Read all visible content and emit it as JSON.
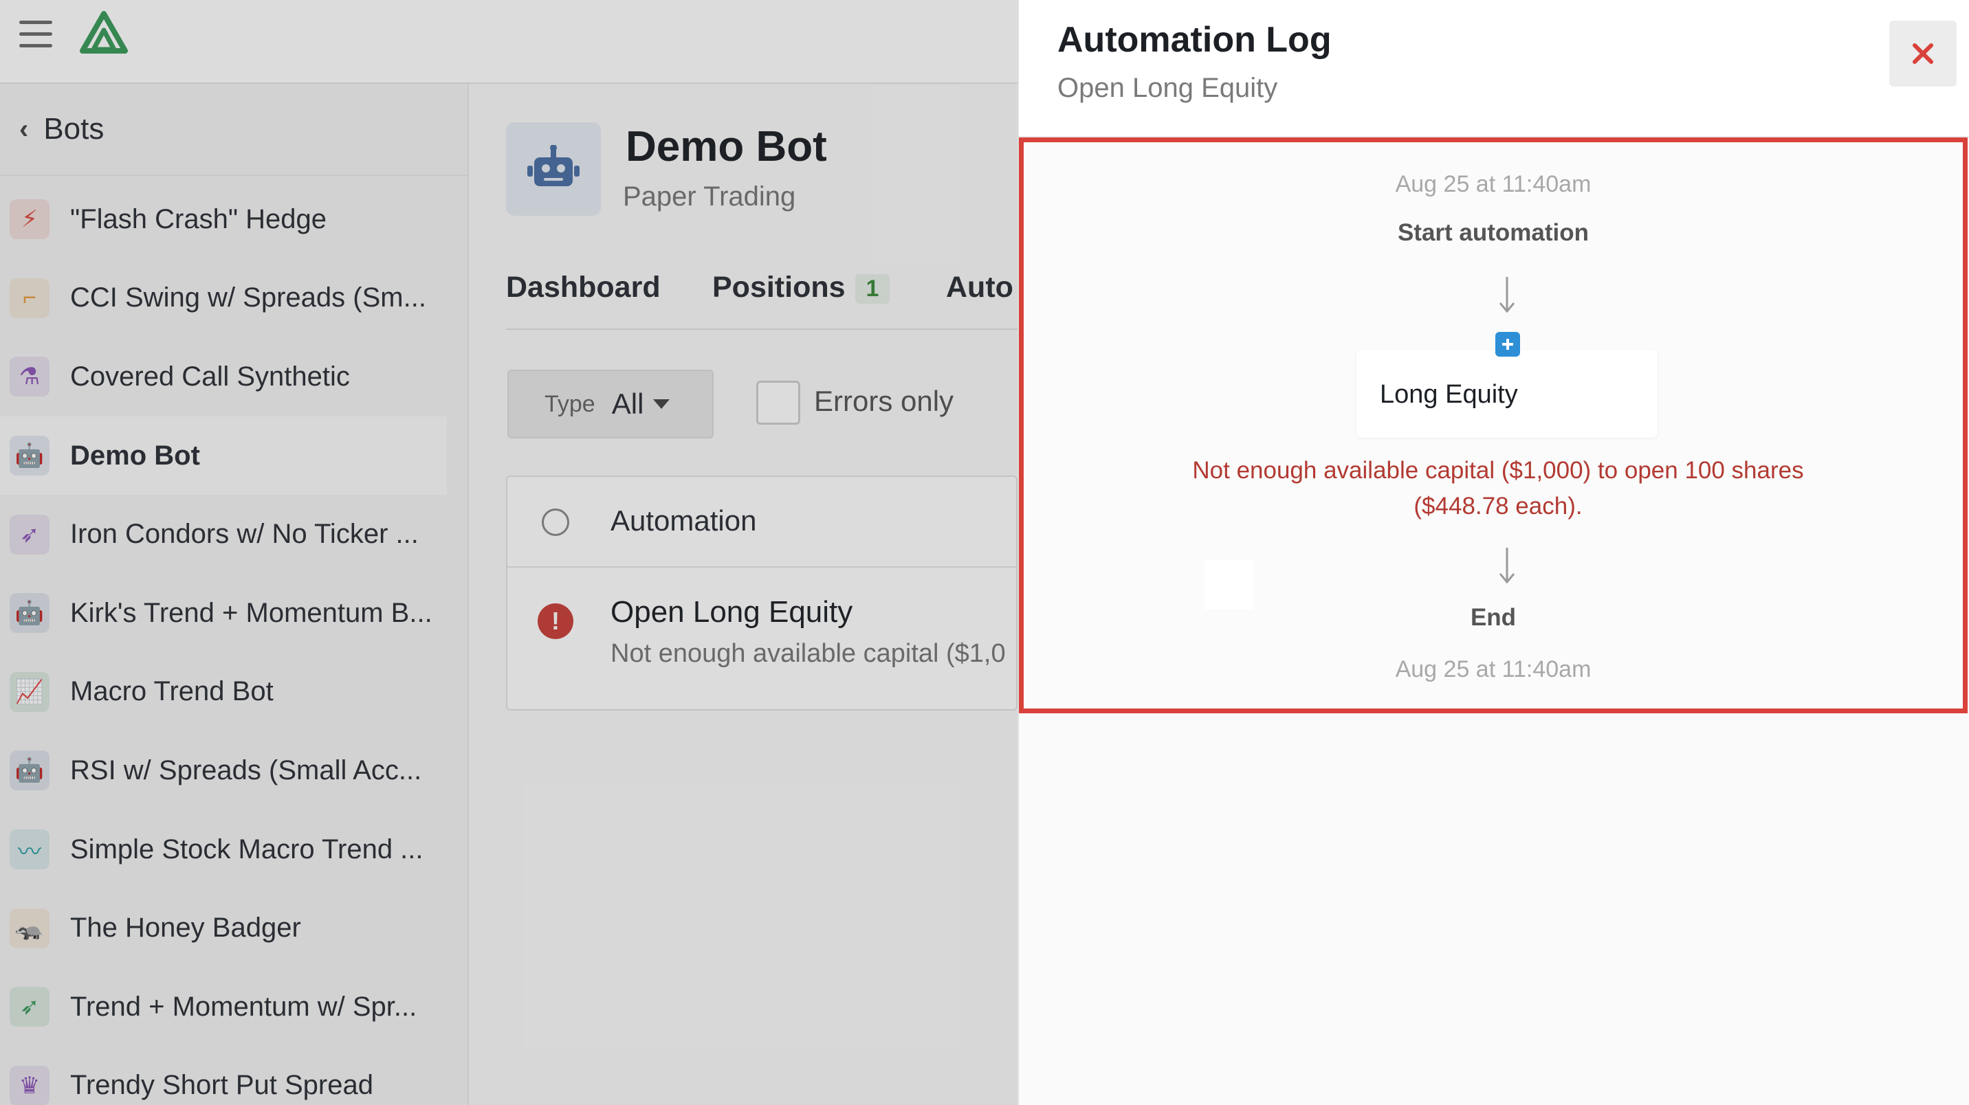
{
  "app": {
    "sidebar": {
      "back_label": "Bots",
      "items": [
        {
          "label": "\"Flash Crash\" Hedge",
          "icon": "lightning-icon",
          "color": "#d94a3f",
          "active": false
        },
        {
          "label": "CCI Swing w/ Spreads (Sm...",
          "icon": "gun-icon",
          "color": "#e39a3b",
          "active": false
        },
        {
          "label": "Covered Call Synthetic",
          "icon": "chemistry-flask-icon",
          "color": "#8d57b8",
          "active": false
        },
        {
          "label": "Demo Bot",
          "icon": "robot-icon",
          "color": "#4a6fa5",
          "active": true
        },
        {
          "label": "Iron Condors w/ No Ticker ...",
          "icon": "rocket-icon",
          "color": "#8d57b8",
          "active": false
        },
        {
          "label": "Kirk's Trend + Momentum B...",
          "icon": "robot-icon",
          "color": "#4a6fa5",
          "active": false
        },
        {
          "label": "Macro Trend Bot",
          "icon": "line-chart-icon",
          "color": "#3a9a5a",
          "active": false
        },
        {
          "label": "RSI w/ Spreads (Small Acc...",
          "icon": "robot-icon",
          "color": "#4a6fa5",
          "active": false
        },
        {
          "label": "Simple Stock Macro Trend ...",
          "icon": "pulse-icon",
          "color": "#2a9da6",
          "active": false
        },
        {
          "label": "The Honey Badger",
          "icon": "badger-icon",
          "color": "#e39a3b",
          "active": false
        },
        {
          "label": "Trend + Momentum w/ Spr...",
          "icon": "rocket-icon",
          "color": "#3a9a5a",
          "active": false
        },
        {
          "label": "Trendy Short Put Spread",
          "icon": "crown-icon",
          "color": "#8d57b8",
          "active": false
        }
      ]
    },
    "bot": {
      "name": "Demo Bot",
      "mode": "Paper Trading"
    },
    "tabs": [
      {
        "label": "Dashboard"
      },
      {
        "label": "Positions",
        "count": "1"
      },
      {
        "label": "Auto"
      }
    ],
    "filters": {
      "type_label": "Type",
      "type_value": "All",
      "errors_only_label": "Errors only"
    },
    "table": {
      "header": "Automation",
      "rows": [
        {
          "title": "Open Long Equity",
          "subtitle": "Not enough available capital ($1,0"
        }
      ]
    }
  },
  "drawer": {
    "title": "Automation Log",
    "subtitle": "Open Long Equity",
    "log": {
      "start_time": "Aug 25 at 11:40am",
      "start_label": "Start automation",
      "action_label": "Long Equity",
      "error_message": "Not enough available capital ($1,000) to open 100 shares ($448.78 each).",
      "end_label": "End",
      "end_time": "Aug 25 at 11:40am"
    }
  },
  "colors": {
    "accent_green": "#3a9a5a",
    "error_red": "#c9403a",
    "highlight_border": "#d9413b",
    "info_blue": "#2e8fd6"
  }
}
